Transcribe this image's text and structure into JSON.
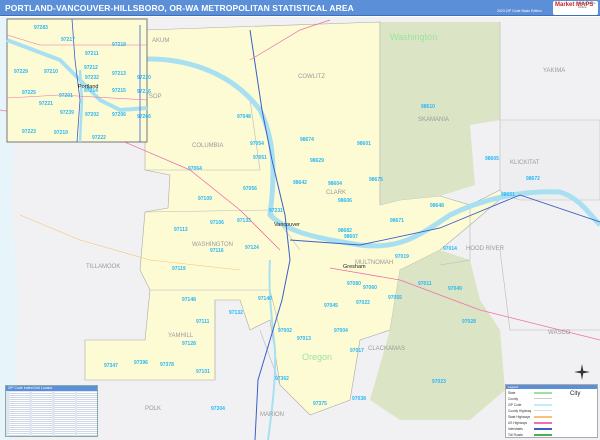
{
  "header": {
    "title": "PORTLAND-VANCOUVER-HILLSBORO, OR-WA METROPOLITAN STATISTICAL AREA",
    "edition": "2023 ZIP Code Basic Edition",
    "logo": "Market MAPS",
    "logo_sub": "Market Maps Online"
  },
  "colors": {
    "title_bar": "#5b8fd8",
    "msa_fill": "#fdfbd4",
    "forest": "#dbe5c5",
    "outside": "#f1f1f3",
    "water": "#a8e0f2",
    "zip_label": "#29b6f6",
    "interstate": "#3b5fc9",
    "us_highway": "#ef6fa8",
    "state_highway": "#f5c27a"
  },
  "states": [
    "Washington",
    "Oregon"
  ],
  "counties": [
    "AKUM",
    "COWLITZ",
    "COLUMBIA",
    "CLARK",
    "SKAMANIA",
    "YAKIMA",
    "KLICKITAT",
    "HOOD RIVER",
    "WASCO",
    "MULTNOMAH",
    "CLACKAMAS",
    "WASHINGTON",
    "TILLAMOOK",
    "YAMHILL",
    "POLK",
    "MARION",
    "CLATSOP"
  ],
  "cities": [
    "Vancouver",
    "Gresham",
    "Portland"
  ],
  "zips": [
    "97048",
    "97054",
    "98674",
    "97051",
    "98629",
    "98601",
    "98610",
    "97064",
    "98604",
    "98642",
    "98675",
    "98605",
    "98672",
    "97056",
    "98606",
    "97109",
    "98651",
    "98648",
    "97231",
    "97133",
    "97106",
    "98682",
    "98671",
    "97113",
    "98607",
    "97124",
    "97116",
    "97014",
    "97019",
    "97119",
    "97080",
    "97060",
    "97011",
    "97049",
    "97148",
    "97140",
    "97045",
    "97022",
    "97055",
    "97132",
    "97111",
    "97028",
    "97002",
    "97004",
    "97013",
    "97128",
    "97017",
    "97347",
    "97396",
    "97378",
    "97101",
    "97362",
    "97023",
    "97038",
    "97375",
    "97304"
  ],
  "inset": {
    "zips": [
      "97283",
      "97217",
      "97218",
      "97211",
      "97229",
      "97210",
      "97212",
      "97232",
      "97213",
      "97220",
      "97214",
      "97215",
      "97216",
      "97225",
      "97201",
      "97221",
      "97239",
      "97202",
      "97206",
      "97266",
      "97223",
      "97219",
      "97222"
    ],
    "city": "Portland"
  },
  "legend": {
    "title": "Legend",
    "items": [
      "State",
      "County",
      "ZIP Code",
      "County Highway",
      "State Highways",
      "US Highways",
      "Interstates",
      "Toll Roads"
    ],
    "city_label": "City",
    "compass": "compass-rose"
  },
  "zip_index": {
    "title": "ZIP Code Index/Grid Locator"
  }
}
